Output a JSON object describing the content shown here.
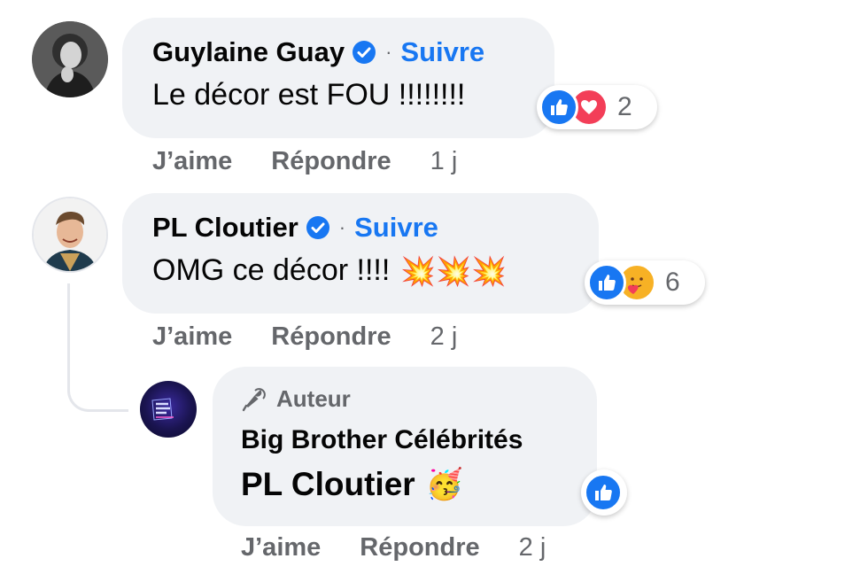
{
  "comments": [
    {
      "author": "Guylaine Guay",
      "follow_label": "Suivre",
      "dot": "·",
      "text": "Le décor est FOU !!!!!!!!",
      "reaction_count": "2",
      "reaction_icons": [
        "like-icon",
        "love-icon"
      ],
      "actions": {
        "like": "J’aime",
        "reply": "Répondre",
        "time": "1 j"
      }
    },
    {
      "author": "PL Cloutier",
      "follow_label": "Suivre",
      "dot": "·",
      "text": "OMG ce décor !!!!",
      "emoji": "💥💥💥",
      "reaction_count": "6",
      "reaction_icons": [
        "like-icon",
        "care-icon"
      ],
      "actions": {
        "like": "J’aime",
        "reply": "Répondre",
        "time": "2 j"
      }
    }
  ],
  "reply": {
    "badge_label": "Auteur",
    "author": "Big Brother Célébrités",
    "mention": "PL Cloutier",
    "emoji": "🥳",
    "reaction_icons": [
      "like-icon"
    ],
    "actions": {
      "like": "J’aime",
      "reply": "Répondre",
      "time": "2 j"
    }
  },
  "colors": {
    "bubble": "#f0f2f5",
    "link": "#1877f2",
    "secondary": "#65676b",
    "love": "#f33e58",
    "care": "#f7b125"
  }
}
